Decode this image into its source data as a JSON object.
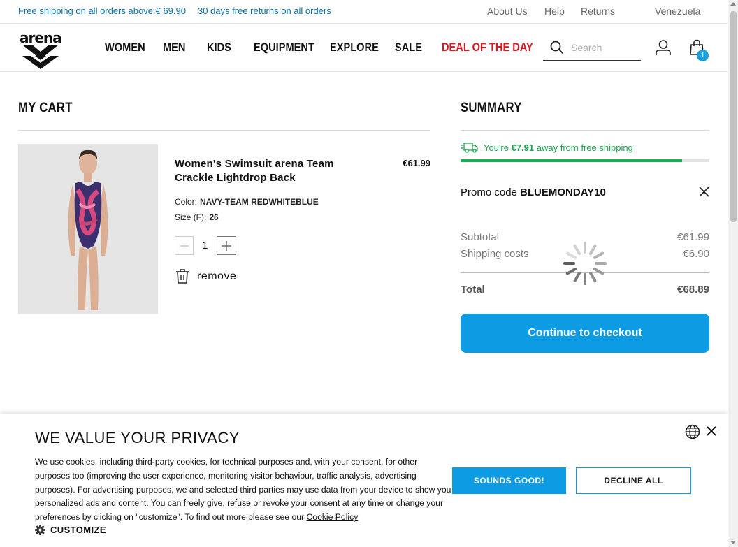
{
  "topbar": {
    "promo_shipping": "Free shipping on all orders above € 69.90",
    "promo_returns": "30 days free returns on all orders",
    "links": [
      "About Us",
      "Help",
      "Returns"
    ],
    "country": "Venezuela"
  },
  "header": {
    "logo_text": "arena",
    "nav": [
      "WOMEN",
      "MEN",
      "KIDS",
      "EQUIPMENT",
      "EXPLORE",
      "SALE",
      "DEAL OF THE DAY"
    ],
    "search_placeholder": "Search",
    "bag_count": "1"
  },
  "cart": {
    "title": "MY CART",
    "item": {
      "name": "Women's Swimsuit arena Team Crackle Lightdrop Back",
      "price": "€61.99",
      "color_label": "Color:",
      "color_value": "NAVY-TEAM REDWHITEBLUE",
      "size_label": "Size (F):",
      "size_value": "26",
      "quantity": "1",
      "remove_label": "remove"
    }
  },
  "summary": {
    "title": "SUMMARY",
    "shipping_prefix": "You're",
    "shipping_amount": "€7.91",
    "shipping_suffix": "away from free shipping",
    "shipping_progress": 0.89,
    "promo_label": "Promo code",
    "promo_code": "BLUEMONDAY10",
    "subtotal_label": "Subtotal",
    "subtotal_value": "€61.99",
    "shipping_label": "Shipping costs",
    "shipping_value": "€6.90",
    "total_label": "Total",
    "total_value": "€68.89",
    "checkout_label": "Continue to checkout"
  },
  "cookie": {
    "title": "WE VALUE YOUR PRIVACY",
    "text": "We use cookies, including third-party cookies, for technical purposes and, with your consent, for other purposes too (improving the user experience, monitoring visitor behaviour, traffic analysis, advertising purposes). For advertising purposes, we and selected third parties may use data from your device to show you personalized ads and content. You can freely give, refuse or revoke your consent at any time or change your preferences by clicking on \"customize\". To find out more please see our",
    "policy_link": "Cookie Policy",
    "customize_label": "CUSTOMIZE",
    "accept_label": "SOUNDS GOOD!",
    "decline_label": "DECLINE ALL"
  },
  "colors": {
    "accent": "#0d9be3",
    "deal": "#d7171f",
    "success": "#19a64c",
    "promo_text": "#0a6fa6"
  }
}
